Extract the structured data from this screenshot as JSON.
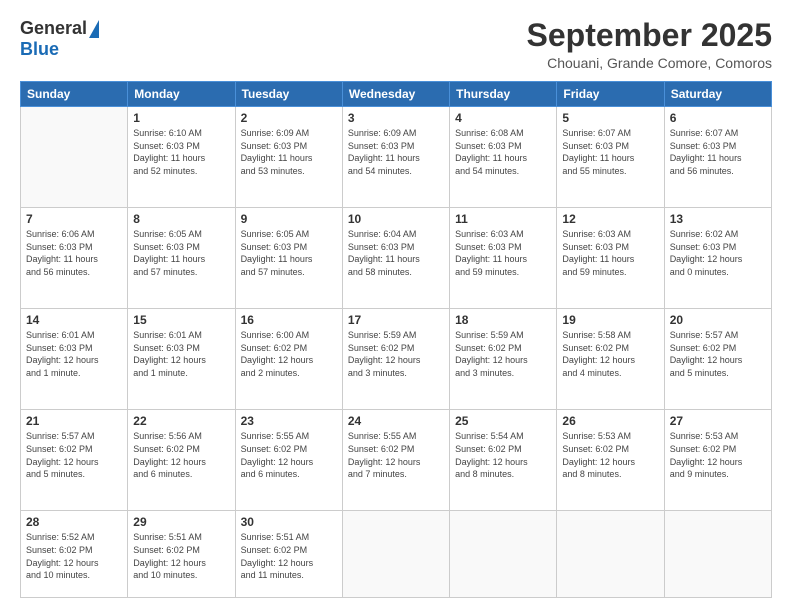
{
  "logo": {
    "general": "General",
    "blue": "Blue"
  },
  "header": {
    "month": "September 2025",
    "location": "Chouani, Grande Comore, Comoros"
  },
  "weekdays": [
    "Sunday",
    "Monday",
    "Tuesday",
    "Wednesday",
    "Thursday",
    "Friday",
    "Saturday"
  ],
  "weeks": [
    [
      {
        "day": "",
        "info": ""
      },
      {
        "day": "1",
        "info": "Sunrise: 6:10 AM\nSunset: 6:03 PM\nDaylight: 11 hours\nand 52 minutes."
      },
      {
        "day": "2",
        "info": "Sunrise: 6:09 AM\nSunset: 6:03 PM\nDaylight: 11 hours\nand 53 minutes."
      },
      {
        "day": "3",
        "info": "Sunrise: 6:09 AM\nSunset: 6:03 PM\nDaylight: 11 hours\nand 54 minutes."
      },
      {
        "day": "4",
        "info": "Sunrise: 6:08 AM\nSunset: 6:03 PM\nDaylight: 11 hours\nand 54 minutes."
      },
      {
        "day": "5",
        "info": "Sunrise: 6:07 AM\nSunset: 6:03 PM\nDaylight: 11 hours\nand 55 minutes."
      },
      {
        "day": "6",
        "info": "Sunrise: 6:07 AM\nSunset: 6:03 PM\nDaylight: 11 hours\nand 56 minutes."
      }
    ],
    [
      {
        "day": "7",
        "info": "Sunrise: 6:06 AM\nSunset: 6:03 PM\nDaylight: 11 hours\nand 56 minutes."
      },
      {
        "day": "8",
        "info": "Sunrise: 6:05 AM\nSunset: 6:03 PM\nDaylight: 11 hours\nand 57 minutes."
      },
      {
        "day": "9",
        "info": "Sunrise: 6:05 AM\nSunset: 6:03 PM\nDaylight: 11 hours\nand 57 minutes."
      },
      {
        "day": "10",
        "info": "Sunrise: 6:04 AM\nSunset: 6:03 PM\nDaylight: 11 hours\nand 58 minutes."
      },
      {
        "day": "11",
        "info": "Sunrise: 6:03 AM\nSunset: 6:03 PM\nDaylight: 11 hours\nand 59 minutes."
      },
      {
        "day": "12",
        "info": "Sunrise: 6:03 AM\nSunset: 6:03 PM\nDaylight: 11 hours\nand 59 minutes."
      },
      {
        "day": "13",
        "info": "Sunrise: 6:02 AM\nSunset: 6:03 PM\nDaylight: 12 hours\nand 0 minutes."
      }
    ],
    [
      {
        "day": "14",
        "info": "Sunrise: 6:01 AM\nSunset: 6:03 PM\nDaylight: 12 hours\nand 1 minute."
      },
      {
        "day": "15",
        "info": "Sunrise: 6:01 AM\nSunset: 6:03 PM\nDaylight: 12 hours\nand 1 minute."
      },
      {
        "day": "16",
        "info": "Sunrise: 6:00 AM\nSunset: 6:02 PM\nDaylight: 12 hours\nand 2 minutes."
      },
      {
        "day": "17",
        "info": "Sunrise: 5:59 AM\nSunset: 6:02 PM\nDaylight: 12 hours\nand 3 minutes."
      },
      {
        "day": "18",
        "info": "Sunrise: 5:59 AM\nSunset: 6:02 PM\nDaylight: 12 hours\nand 3 minutes."
      },
      {
        "day": "19",
        "info": "Sunrise: 5:58 AM\nSunset: 6:02 PM\nDaylight: 12 hours\nand 4 minutes."
      },
      {
        "day": "20",
        "info": "Sunrise: 5:57 AM\nSunset: 6:02 PM\nDaylight: 12 hours\nand 5 minutes."
      }
    ],
    [
      {
        "day": "21",
        "info": "Sunrise: 5:57 AM\nSunset: 6:02 PM\nDaylight: 12 hours\nand 5 minutes."
      },
      {
        "day": "22",
        "info": "Sunrise: 5:56 AM\nSunset: 6:02 PM\nDaylight: 12 hours\nand 6 minutes."
      },
      {
        "day": "23",
        "info": "Sunrise: 5:55 AM\nSunset: 6:02 PM\nDaylight: 12 hours\nand 6 minutes."
      },
      {
        "day": "24",
        "info": "Sunrise: 5:55 AM\nSunset: 6:02 PM\nDaylight: 12 hours\nand 7 minutes."
      },
      {
        "day": "25",
        "info": "Sunrise: 5:54 AM\nSunset: 6:02 PM\nDaylight: 12 hours\nand 8 minutes."
      },
      {
        "day": "26",
        "info": "Sunrise: 5:53 AM\nSunset: 6:02 PM\nDaylight: 12 hours\nand 8 minutes."
      },
      {
        "day": "27",
        "info": "Sunrise: 5:53 AM\nSunset: 6:02 PM\nDaylight: 12 hours\nand 9 minutes."
      }
    ],
    [
      {
        "day": "28",
        "info": "Sunrise: 5:52 AM\nSunset: 6:02 PM\nDaylight: 12 hours\nand 10 minutes."
      },
      {
        "day": "29",
        "info": "Sunrise: 5:51 AM\nSunset: 6:02 PM\nDaylight: 12 hours\nand 10 minutes."
      },
      {
        "day": "30",
        "info": "Sunrise: 5:51 AM\nSunset: 6:02 PM\nDaylight: 12 hours\nand 11 minutes."
      },
      {
        "day": "",
        "info": ""
      },
      {
        "day": "",
        "info": ""
      },
      {
        "day": "",
        "info": ""
      },
      {
        "day": "",
        "info": ""
      }
    ]
  ]
}
